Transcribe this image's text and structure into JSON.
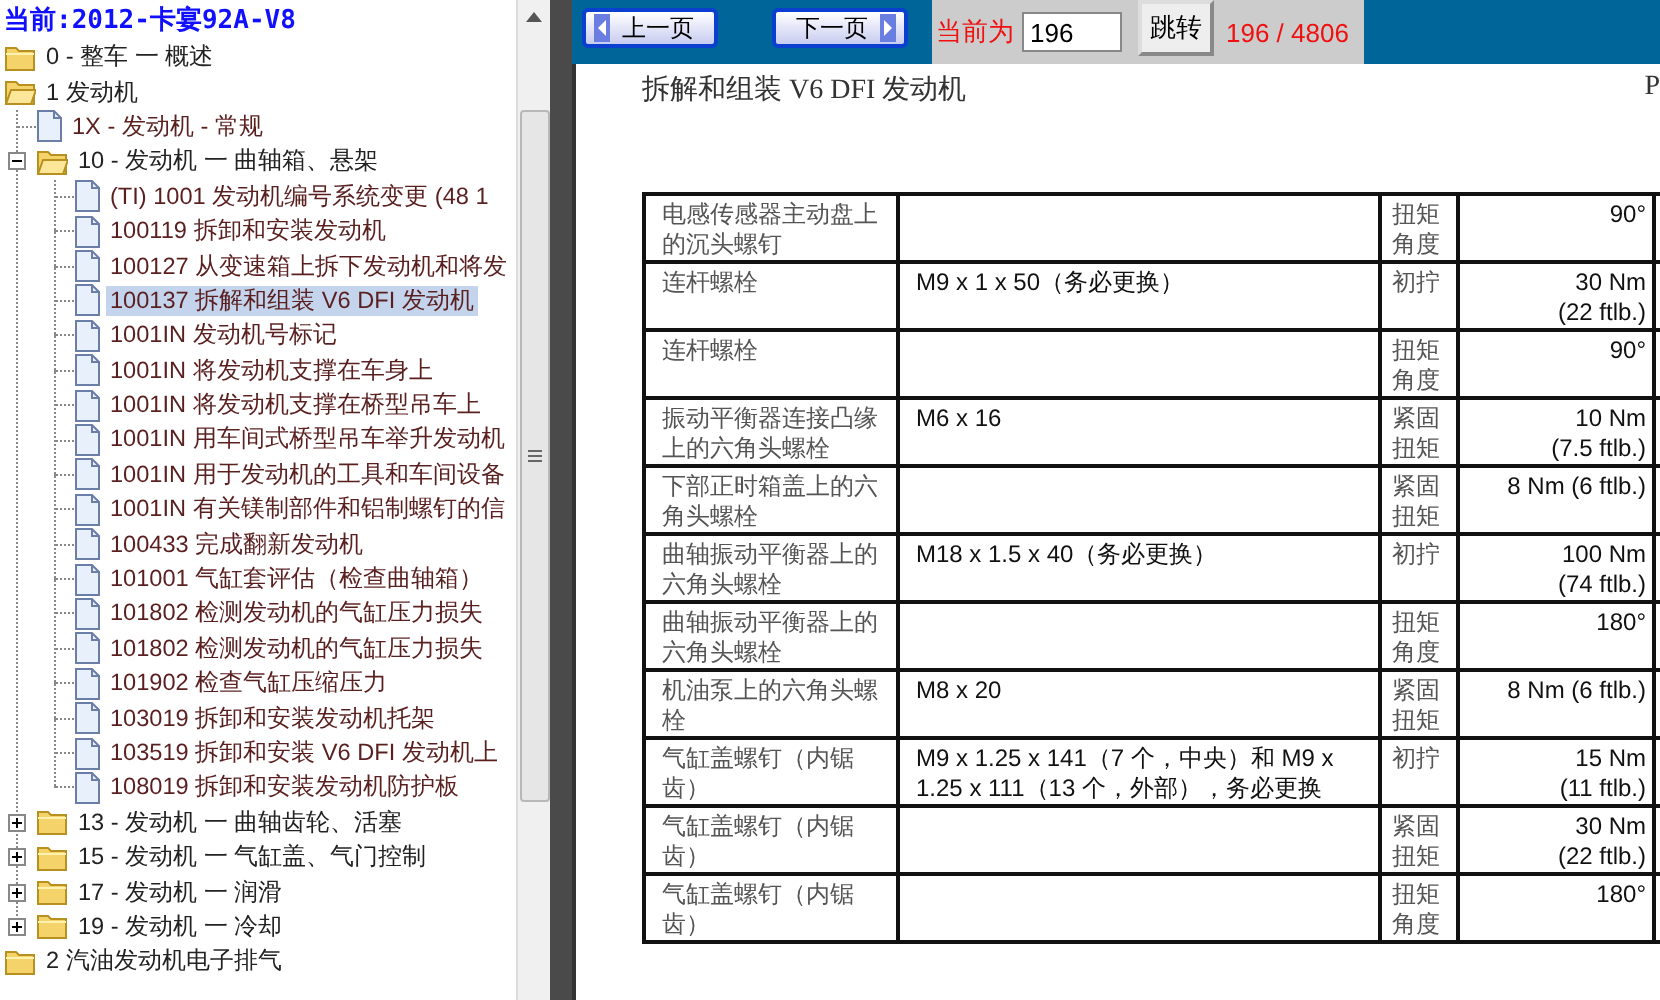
{
  "current": "当前:2012-卡宴92A-V8",
  "tree": [
    {
      "label": "0 - 整车 一 概述",
      "kind": "folder",
      "expanded": false,
      "selected": false
    },
    {
      "label": "1 发动机",
      "kind": "folder",
      "expanded": true,
      "selected": false,
      "children": [
        {
          "label": "1X - 发动机 - 常规",
          "kind": "doc",
          "selected": false
        },
        {
          "label": "10 - 发动机 一 曲轴箱、悬架",
          "kind": "folder",
          "expanded": true,
          "selected": false,
          "children": [
            {
              "label": "(TI) 1001 发动机编号系统变更 (48 1",
              "kind": "doc",
              "selected": false
            },
            {
              "label": "100119 拆卸和安装发动机",
              "kind": "doc",
              "selected": false
            },
            {
              "label": "100127 从变速箱上拆下发动机和将发",
              "kind": "doc",
              "selected": false
            },
            {
              "label": "100137 拆解和组装 V6 DFI 发动机",
              "kind": "doc",
              "selected": true
            },
            {
              "label": "1001IN 发动机号标记",
              "kind": "doc",
              "selected": false
            },
            {
              "label": "1001IN 将发动机支撑在车身上",
              "kind": "doc",
              "selected": false
            },
            {
              "label": "1001IN 将发动机支撑在桥型吊车上",
              "kind": "doc",
              "selected": false
            },
            {
              "label": "1001IN 用车间式桥型吊车举升发动机",
              "kind": "doc",
              "selected": false
            },
            {
              "label": "1001IN 用于发动机的工具和车间设备",
              "kind": "doc",
              "selected": false
            },
            {
              "label": "1001IN 有关镁制部件和铝制螺钉的信",
              "kind": "doc",
              "selected": false
            },
            {
              "label": "100433 完成翻新发动机",
              "kind": "doc",
              "selected": false
            },
            {
              "label": "101001 气缸套评估（检查曲轴箱）",
              "kind": "doc",
              "selected": false
            },
            {
              "label": "101802 检测发动机的气缸压力损失",
              "kind": "doc",
              "selected": false
            },
            {
              "label": "101802 检测发动机的气缸压力损失",
              "kind": "doc",
              "selected": false
            },
            {
              "label": "101902 检查气缸压缩压力",
              "kind": "doc",
              "selected": false
            },
            {
              "label": "103019 拆卸和安装发动机托架",
              "kind": "doc",
              "selected": false
            },
            {
              "label": "103519 拆卸和安装 V6 DFI 发动机上",
              "kind": "doc",
              "selected": false
            },
            {
              "label": "108019 拆卸和安装发动机防护板",
              "kind": "doc",
              "selected": false
            }
          ]
        },
        {
          "label": "13 - 发动机 一 曲轴齿轮、活塞",
          "kind": "folder",
          "expanded": false,
          "selected": false
        },
        {
          "label": "15 - 发动机 一 气缸盖、气门控制",
          "kind": "folder",
          "expanded": false,
          "selected": false
        },
        {
          "label": "17 - 发动机 一 润滑",
          "kind": "folder",
          "expanded": false,
          "selected": false
        },
        {
          "label": "19 - 发动机 一 冷却",
          "kind": "folder",
          "expanded": false,
          "selected": false
        }
      ]
    },
    {
      "label": "2 汽油发动机电子排气",
      "kind": "folder",
      "expanded": false,
      "selected": false
    }
  ],
  "toolbar": {
    "prev": "上一页",
    "next": "下一页",
    "page_label": "当前为",
    "page_value": "196",
    "go": "跳转",
    "page_count": "196 / 4806"
  },
  "document": {
    "title": "拆解和组装  V6 DFI 发动机",
    "corner": "P",
    "rows": [
      {
        "part": "电感传感器主动盘上的沉头螺钉",
        "spec": "",
        "step": "扭矩角度",
        "value": "90°"
      },
      {
        "part": "连杆螺栓",
        "spec": "M9 x 1 x 50（务必更换）",
        "step": "初拧",
        "value": "30 Nm\n(22 ftlb.)"
      },
      {
        "part": "连杆螺栓",
        "spec": "",
        "step": "扭矩角度",
        "value": "90°"
      },
      {
        "part": "振动平衡器连接凸缘上的六角头螺栓",
        "spec": "M6 x 16",
        "step": "紧固扭矩",
        "value": "10 Nm\n(7.5 ftlb.)"
      },
      {
        "part": "下部正时箱盖上的六角头螺栓",
        "spec": "",
        "step": "紧固扭矩",
        "value": "8 Nm (6 ftlb.)"
      },
      {
        "part": "曲轴振动平衡器上的六角头螺栓",
        "spec": "M18 x 1.5 x 40（务必更换）",
        "step": "初拧",
        "value": "100 Nm\n(74 ftlb.)"
      },
      {
        "part": "曲轴振动平衡器上的六角头螺栓",
        "spec": "",
        "step": "扭矩角度",
        "value": "180°"
      },
      {
        "part": "机油泵上的六角头螺栓",
        "spec": "M8 x 20",
        "step": "紧固扭矩",
        "value": "8 Nm (6 ftlb.)"
      },
      {
        "part": "气缸盖螺钉（内锯齿）",
        "spec": "M9 x 1.25 x 141（7 个，中央）和  M9 x 1.25 x 111（13 个，外部），务必更换",
        "step": "初拧",
        "value": "15 Nm\n(11 ftlb.)"
      },
      {
        "part": "气缸盖螺钉（内锯齿）",
        "spec": "",
        "step": "紧固扭矩",
        "value": "30 Nm\n(22 ftlb.)"
      },
      {
        "part": "气缸盖螺钉（内锯齿）",
        "spec": "",
        "step": "扭矩角度",
        "value": "180°"
      }
    ]
  }
}
